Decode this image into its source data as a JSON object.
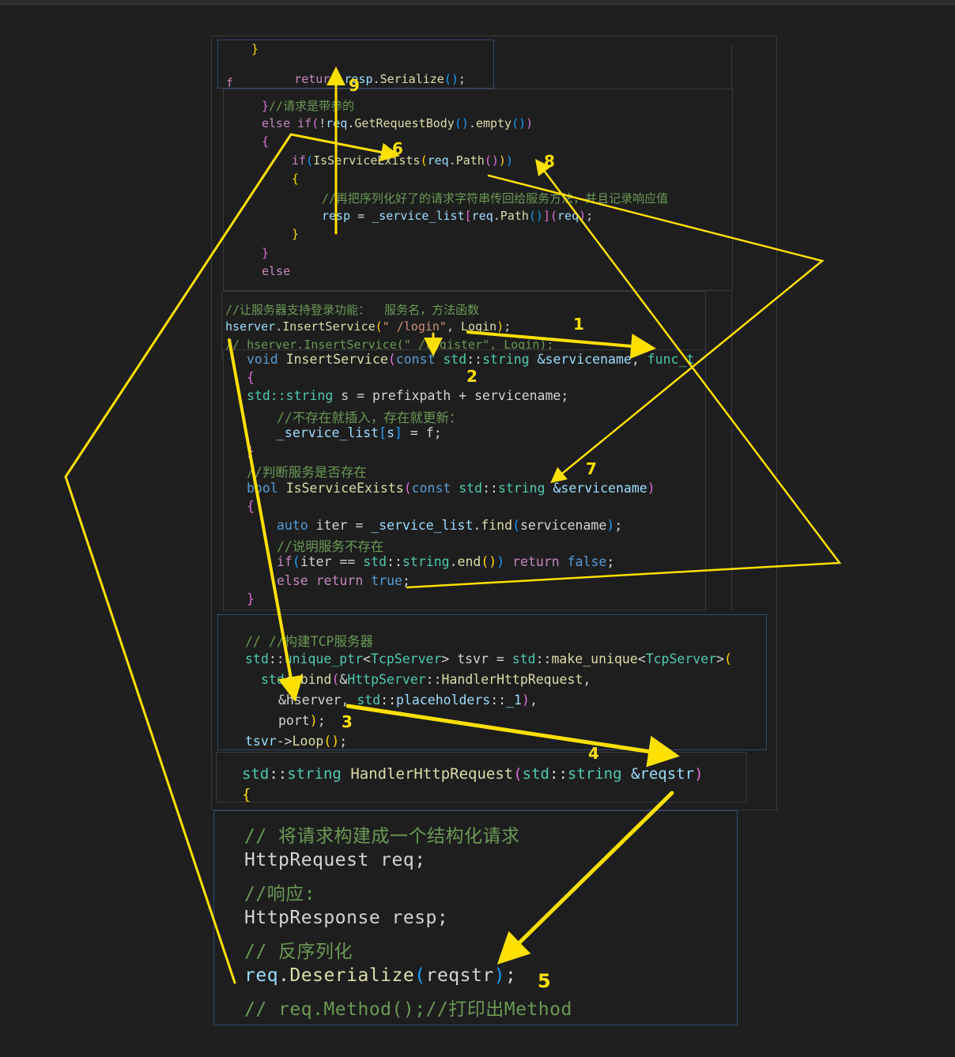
{
  "snippets": {
    "serialize": {
      "l1": "}",
      "l2": "return resp.Serialize();"
    },
    "body_request": {
      "l1": "}//请求是带参的",
      "l2": "else if(!req.GetRequestBody().empty())",
      "l3": "{",
      "l4": "if(IsServiceExists(req.Path()))",
      "l5": "{",
      "l6": "//再把序列化好了的请求字符串传回给服务方法，并且记录响应值",
      "l7": "resp = _service_list[req.Path()](req);",
      "l8": "}",
      "l9": "}",
      "l10": "else"
    },
    "register": {
      "c1": "//让服务器支持登录功能：  服务名，方法函数",
      "l2": "hserver.InsertService(\" /login\", Login);",
      "l3": "// hserver.InsertService(\" /register\", Login);"
    },
    "insert_service": {
      "l1": "void InsertService(const std::string &servicename, func_t f)",
      "l2": "{",
      "l3": "std::string s = prefixpath + servicename;",
      "l4": "//不存在就插入，存在就更新：",
      "l5": "_service_list[s] = f;",
      "l6": "}",
      "l7": "//判断服务是否存在",
      "l8": "bool IsServiceExists(const std::string &servicename)",
      "l9": "{",
      "l10": "auto iter = _service_list.find(servicename);",
      "l11": "//说明服务不存在",
      "l12": "if(iter == std::string.end()) return false;",
      "l13": "else return true;",
      "l14": "}"
    },
    "tcp_server": {
      "l1": "// //构建TCP服务器",
      "l2": "std::unique_ptr<TcpServer> tsvr = std::make_unique<TcpServer>(",
      "l3": "std::bind(&HttpServer::HandlerHttpRequest,",
      "l4": "&hserver, std::placeholders::_1),",
      "l5": "port);",
      "l6": "tsvr->Loop();"
    },
    "handler": {
      "l1": "std::string HandlerHttpRequest(std::string &reqstr)",
      "l2": "{"
    },
    "deserialize": {
      "l1": "// 将请求构建成一个结构化请求",
      "l2": "HttpRequest req;",
      "l3": "//响应:",
      "l4": "HttpResponse resp;",
      "l5": "// 反序列化",
      "l6": "req.Deserialize(reqstr);",
      "l7": "// req.Method();//打印出Method"
    }
  },
  "steps": [
    "1",
    "2",
    "3",
    "4",
    "5",
    "6",
    "7",
    "8",
    "9"
  ],
  "colors": {
    "annotation": "#ffe000",
    "background": "#1f1f1f",
    "panel_border": "#2f4b6e"
  }
}
